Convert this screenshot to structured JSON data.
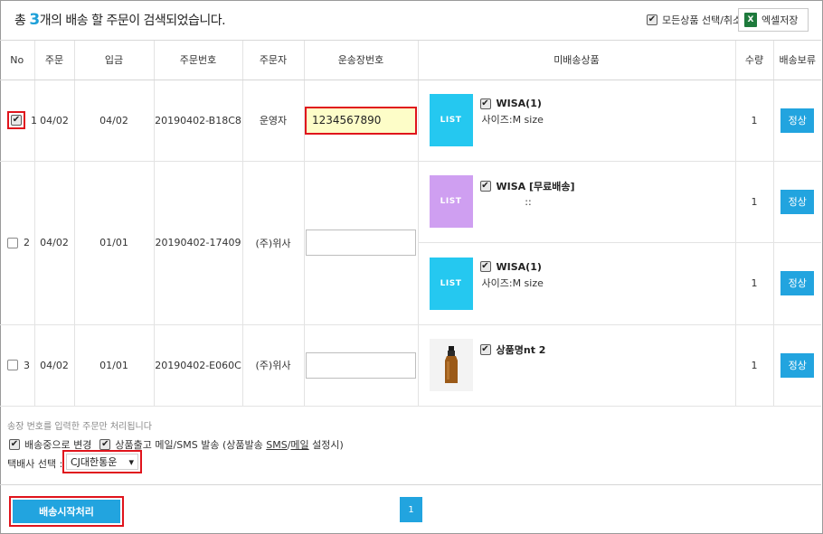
{
  "header": {
    "title_prefix": "총 ",
    "title_count": "3",
    "title_suffix": "개의 배송 할 주문이 검색되었습니다.",
    "select_all_label": "모든상품 선택/취소",
    "select_all_checked": true,
    "excel_icon_letter": "X",
    "excel_label": "엑셀저장"
  },
  "table": {
    "columns": [
      "No",
      "주문",
      "입금",
      "주문번호",
      "주문자",
      "운송장번호",
      "미배송상품",
      "수량",
      "배송보류"
    ],
    "checkmark": "✔",
    "rows": [
      {
        "no": "1",
        "checked": true,
        "order_date": "04/02",
        "paid_date": "04/02",
        "order_number": "20190402-B18C8",
        "customer": "운영자",
        "invoice_value": "1234567890",
        "invoice_placeholder": "",
        "items": [
          {
            "thumb": "LIST",
            "thumb_color": "#25c8f0",
            "name": "WISA(1)",
            "option": "사이즈:M size",
            "qty": "1",
            "status": "정상"
          }
        ]
      },
      {
        "no": "2",
        "checked": false,
        "order_date": "04/02",
        "paid_date": "01/01",
        "order_number": "20190402-17409",
        "customer": "(주)위사",
        "invoice_value": "",
        "invoice_placeholder": "",
        "items": [
          {
            "thumb": "LIST",
            "thumb_color": "#cf9ff1",
            "name": "WISA [무료배송]",
            "option": "::",
            "qty": "1",
            "status": "정상"
          },
          {
            "thumb": "LIST",
            "thumb_color": "#25c8f0",
            "name": "WISA(1)",
            "option": "사이즈:M size",
            "qty": "1",
            "status": "정상"
          }
        ]
      },
      {
        "no": "3",
        "checked": false,
        "order_date": "04/02",
        "paid_date": "01/01",
        "order_number": "20190402-E060C",
        "customer": "(주)위사",
        "invoice_value": "",
        "invoice_placeholder": "",
        "items": [
          {
            "thumb": "",
            "thumb_color": "#f3f3f3",
            "name": "상품명nt 2",
            "option": "",
            "qty": "1",
            "status": "정상"
          }
        ]
      }
    ]
  },
  "options": {
    "note": "송장 번호를 입력한 주문만 처리됩니다",
    "change_status_label": "배송중으로 변경",
    "change_status_checked": true,
    "mail_label_prefix": "상품출고 메일/SMS 발송 (상품발송 ",
    "mail_label_sms": "SMS",
    "mail_label_sep": "/",
    "mail_label_mail": "메일",
    "mail_label_suffix": " 설정시)",
    "mail_checked": true,
    "courier_label": "택배사 선택 :",
    "courier_value": "CJ대한통운",
    "courier_arrow": "▾"
  },
  "footer": {
    "start_button": "배송시작처리",
    "page_number": "1"
  }
}
